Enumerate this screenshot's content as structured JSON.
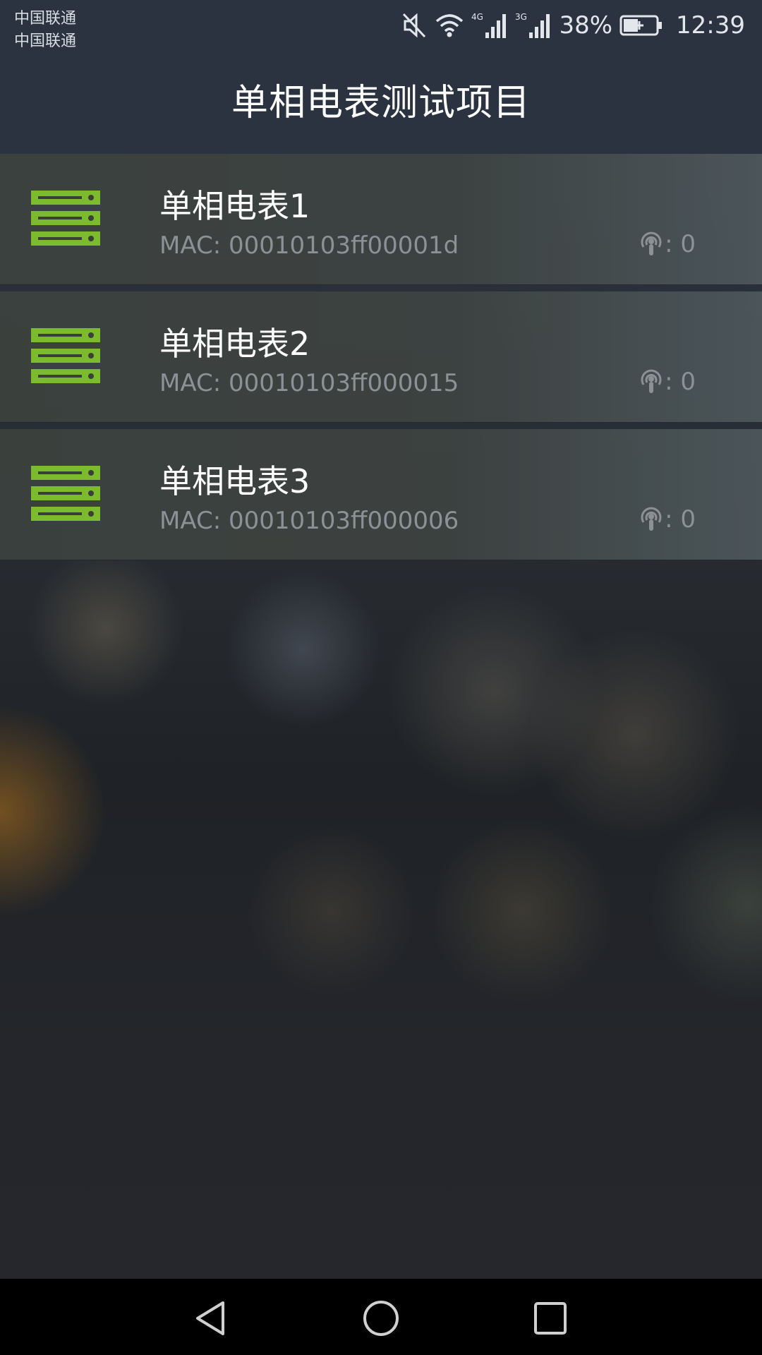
{
  "status_bar": {
    "carrier_1": "中国联通",
    "carrier_2": "中国联通",
    "network_1": "4G",
    "network_2": "3G",
    "battery": "38%",
    "time": "12:39",
    "icons": [
      "mute-icon",
      "wifi-icon",
      "signal-icon",
      "signal-icon",
      "battery-charging-icon"
    ]
  },
  "header": {
    "title": "单相电表测试项目"
  },
  "devices": [
    {
      "name": "单相电表1",
      "mac": "MAC: 00010103ff00001d",
      "signal": ": 0"
    },
    {
      "name": "单相电表2",
      "mac": "MAC: 00010103ff000015",
      "signal": ": 0"
    },
    {
      "name": "单相电表3",
      "mac": "MAC: 00010103ff000006",
      "signal": ": 0"
    }
  ],
  "colors": {
    "accent_green": "#7cbb2e",
    "mac_text": "#8c9196"
  },
  "nav_bar": {
    "icons": [
      "back-icon",
      "home-icon",
      "recents-icon"
    ]
  }
}
